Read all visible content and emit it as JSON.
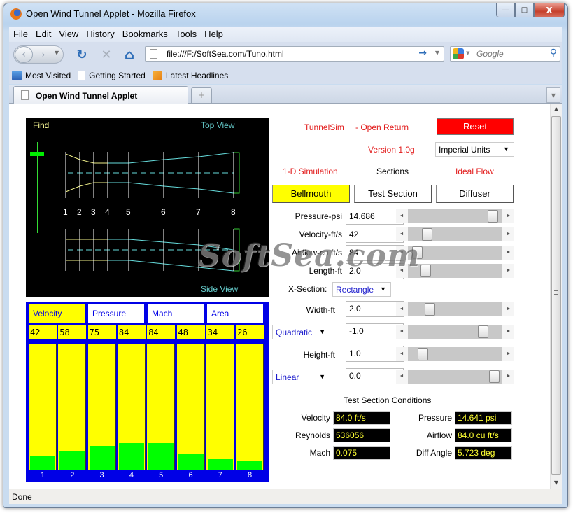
{
  "window": {
    "title": "Open Wind Tunnel Applet - Mozilla Firefox",
    "controls": {
      "minimize": "▭",
      "maximize": "□",
      "close": "X"
    }
  },
  "menu": [
    {
      "label": "File",
      "accel": "F"
    },
    {
      "label": "Edit",
      "accel": "E"
    },
    {
      "label": "View",
      "accel": "V"
    },
    {
      "label": "History",
      "accel": "s"
    },
    {
      "label": "Bookmarks",
      "accel": "B"
    },
    {
      "label": "Tools",
      "accel": "T"
    },
    {
      "label": "Help",
      "accel": "H"
    }
  ],
  "nav": {
    "url": "file:///F:/SoftSea.com/Tuno.html",
    "search_placeholder": "Google",
    "icons": {
      "back": "‹",
      "forward": "›",
      "reload": "↻",
      "stop": "✕",
      "home": "⌂",
      "go": "→",
      "search": "⚲"
    }
  },
  "bookmarks": [
    {
      "label": "Most Visited",
      "icon": "most-visited"
    },
    {
      "label": "Getting Started",
      "icon": "page"
    },
    {
      "label": "Latest Headlines",
      "icon": "rss"
    }
  ],
  "tabs": [
    {
      "label": "Open Wind Tunnel Applet",
      "active": true
    }
  ],
  "new_tab_symbol": "+",
  "status": "Done",
  "applet": {
    "view": {
      "find_label": "Find",
      "top_view_label": "Top View",
      "side_view_label": "Side View",
      "station_labels": [
        "1",
        "2",
        "3",
        "4",
        "5",
        "6",
        "7",
        "8"
      ]
    },
    "bars": {
      "tabs": [
        {
          "label": "Velocity",
          "active": true
        },
        {
          "label": "Pressure",
          "active": false
        },
        {
          "label": "Mach",
          "active": false
        },
        {
          "label": "Area",
          "active": false
        }
      ],
      "values": [
        "42",
        "58",
        "75",
        "84",
        "84",
        "48",
        "34",
        "26"
      ],
      "fill_max": 400,
      "station_numbers": [
        "1",
        "2",
        "3",
        "4",
        "5",
        "6",
        "7",
        "8"
      ]
    },
    "header": {
      "app_name": "TunnelSim",
      "mode": "- Open Return",
      "version": "Version 1.0g",
      "reset_label": "Reset",
      "units": "Imperial Units",
      "sim_label": "1-D Simulation",
      "sections_label": "Sections",
      "flow_label": "Ideal Flow"
    },
    "sections": [
      {
        "label": "Bellmouth",
        "active": true
      },
      {
        "label": "Test Section",
        "active": false
      },
      {
        "label": "Diffuser",
        "active": false
      }
    ],
    "inputs": [
      {
        "label": "Pressure-psi",
        "value": "14.686",
        "slider_pos": 0.95
      },
      {
        "label": "Velocity-ft/s",
        "value": "42",
        "slider_pos": 0.17
      },
      {
        "label": "Airflow-cu ft/s",
        "value": "84",
        "slider_pos": 0.05
      },
      {
        "label": "Length-ft",
        "value": "2.0",
        "slider_pos": 0.15
      }
    ],
    "xsection": {
      "label": "X-Section:",
      "value": "Rectangle"
    },
    "shape_inputs": [
      {
        "label": "Width-ft",
        "value": "2.0",
        "slider_pos": 0.2,
        "is_select": false
      },
      {
        "label": "Quadratic",
        "value": "-1.0",
        "slider_pos": 0.83,
        "is_select": true
      },
      {
        "label": "Height-ft",
        "value": "1.0",
        "slider_pos": 0.12,
        "is_select": false
      },
      {
        "label": "Linear",
        "value": "0.0",
        "slider_pos": 0.97,
        "is_select": true
      }
    ],
    "conditions": {
      "title": "Test Section  Conditions",
      "left": [
        {
          "label": "Velocity",
          "value": "84.0 ft/s"
        },
        {
          "label": "Reynolds",
          "value": "536056"
        },
        {
          "label": "Mach",
          "value": "0.075"
        }
      ],
      "right": [
        {
          "label": "Pressure",
          "value": "14.641 psi"
        },
        {
          "label": "Airflow",
          "value": "84.0 cu ft/s"
        },
        {
          "label": "Diff Angle",
          "value": "5.723 deg"
        }
      ]
    }
  },
  "watermark": "SoftSea.com",
  "colors": {
    "bar_fill": "#00ff00",
    "bar_bg": "#ffff00",
    "panel_blue": "#0000e6",
    "reset_red": "#ff0000",
    "label_red": "#e21b1b",
    "output_text": "#ffff33"
  }
}
